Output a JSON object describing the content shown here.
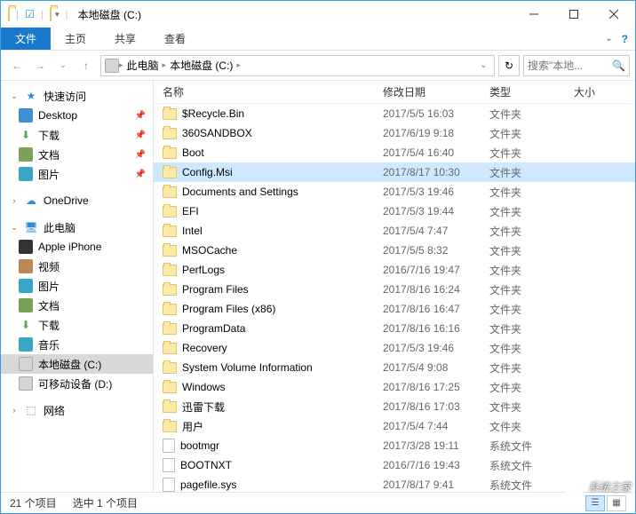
{
  "title": "本地磁盘 (C:)",
  "ribbon": {
    "file": "文件",
    "tabs": [
      "主页",
      "共享",
      "查看"
    ]
  },
  "breadcrumb": [
    "此电脑",
    "本地磁盘 (C:)"
  ],
  "search_placeholder": "搜索\"本地...",
  "columns": {
    "name": "名称",
    "date": "修改日期",
    "type": "类型",
    "size": "大小"
  },
  "nav": {
    "quick": {
      "label": "快速访问",
      "items": [
        {
          "label": "Desktop",
          "icon": "desktop",
          "pinned": true
        },
        {
          "label": "下载",
          "icon": "dl",
          "pinned": true
        },
        {
          "label": "文档",
          "icon": "doc",
          "pinned": true
        },
        {
          "label": "图片",
          "icon": "pic",
          "pinned": true
        }
      ]
    },
    "onedrive": {
      "label": "OneDrive"
    },
    "thispc": {
      "label": "此电脑",
      "items": [
        {
          "label": "Apple iPhone",
          "icon": "phone"
        },
        {
          "label": "视频",
          "icon": "vid"
        },
        {
          "label": "图片",
          "icon": "pic"
        },
        {
          "label": "文档",
          "icon": "doc"
        },
        {
          "label": "下载",
          "icon": "dl"
        },
        {
          "label": "音乐",
          "icon": "music"
        },
        {
          "label": "本地磁盘 (C:)",
          "icon": "drive",
          "selected": true
        },
        {
          "label": "可移动设备 (D:)",
          "icon": "drive"
        }
      ]
    },
    "network": {
      "label": "网络"
    }
  },
  "files": [
    {
      "name": "$Recycle.Bin",
      "date": "2017/5/5 16:03",
      "type": "文件夹",
      "kind": "folder"
    },
    {
      "name": "360SANDBOX",
      "date": "2017/6/19 9:18",
      "type": "文件夹",
      "kind": "folder"
    },
    {
      "name": "Boot",
      "date": "2017/5/4 16:40",
      "type": "文件夹",
      "kind": "folder"
    },
    {
      "name": "Config.Msi",
      "date": "2017/8/17 10:30",
      "type": "文件夹",
      "kind": "folder",
      "selected": true
    },
    {
      "name": "Documents and Settings",
      "date": "2017/5/3 19:46",
      "type": "文件夹",
      "kind": "folder"
    },
    {
      "name": "EFI",
      "date": "2017/5/3 19:44",
      "type": "文件夹",
      "kind": "folder"
    },
    {
      "name": "Intel",
      "date": "2017/5/4 7:47",
      "type": "文件夹",
      "kind": "folder"
    },
    {
      "name": "MSOCache",
      "date": "2017/5/5 8:32",
      "type": "文件夹",
      "kind": "folder"
    },
    {
      "name": "PerfLogs",
      "date": "2016/7/16 19:47",
      "type": "文件夹",
      "kind": "folder"
    },
    {
      "name": "Program Files",
      "date": "2017/8/16 16:24",
      "type": "文件夹",
      "kind": "folder"
    },
    {
      "name": "Program Files (x86)",
      "date": "2017/8/16 16:47",
      "type": "文件夹",
      "kind": "folder"
    },
    {
      "name": "ProgramData",
      "date": "2017/8/16 16:16",
      "type": "文件夹",
      "kind": "folder"
    },
    {
      "name": "Recovery",
      "date": "2017/5/3 19:46",
      "type": "文件夹",
      "kind": "folder"
    },
    {
      "name": "System Volume Information",
      "date": "2017/5/4 9:08",
      "type": "文件夹",
      "kind": "folder"
    },
    {
      "name": "Windows",
      "date": "2017/8/16 17:25",
      "type": "文件夹",
      "kind": "folder"
    },
    {
      "name": "迅雷下载",
      "date": "2017/8/16 17:03",
      "type": "文件夹",
      "kind": "folder"
    },
    {
      "name": "用户",
      "date": "2017/5/4 7:44",
      "type": "文件夹",
      "kind": "folder"
    },
    {
      "name": "bootmgr",
      "date": "2017/3/28 19:11",
      "type": "系统文件",
      "kind": "file"
    },
    {
      "name": "BOOTNXT",
      "date": "2016/7/16 19:43",
      "type": "系统文件",
      "kind": "file"
    },
    {
      "name": "pagefile.sys",
      "date": "2017/8/17 9:41",
      "type": "系统文件",
      "kind": "file"
    }
  ],
  "status": {
    "count": "21 个项目",
    "selected": "选中 1 个项目"
  },
  "watermark": "系统之家"
}
